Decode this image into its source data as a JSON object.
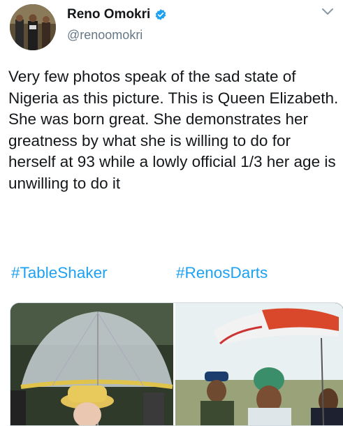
{
  "author": {
    "display_name": "Reno Omokri",
    "handle": "@renoomokri",
    "verified_icon": "verified-badge-icon",
    "avatar_icon": "profile-photo"
  },
  "tweet": {
    "text": "Very few photos speak of the sad state of Nigeria as this picture. This is Queen Elizabeth. She was born great. She demonstrates her greatness by what she is willing to do for herself at 93 while a lowly official 1/3 her age is unwilling to do it",
    "hashtags": [
      "#TableShaker",
      "#RenosDarts"
    ]
  },
  "menu_icon": "chevron-down-icon",
  "colors": {
    "link": "#1da1f2",
    "text": "#14171a",
    "secondary": "#657786",
    "verified": "#1da1f2"
  },
  "media": {
    "left_photo": "queen-with-clear-umbrella",
    "right_photo": "official-with-held-umbrella"
  }
}
